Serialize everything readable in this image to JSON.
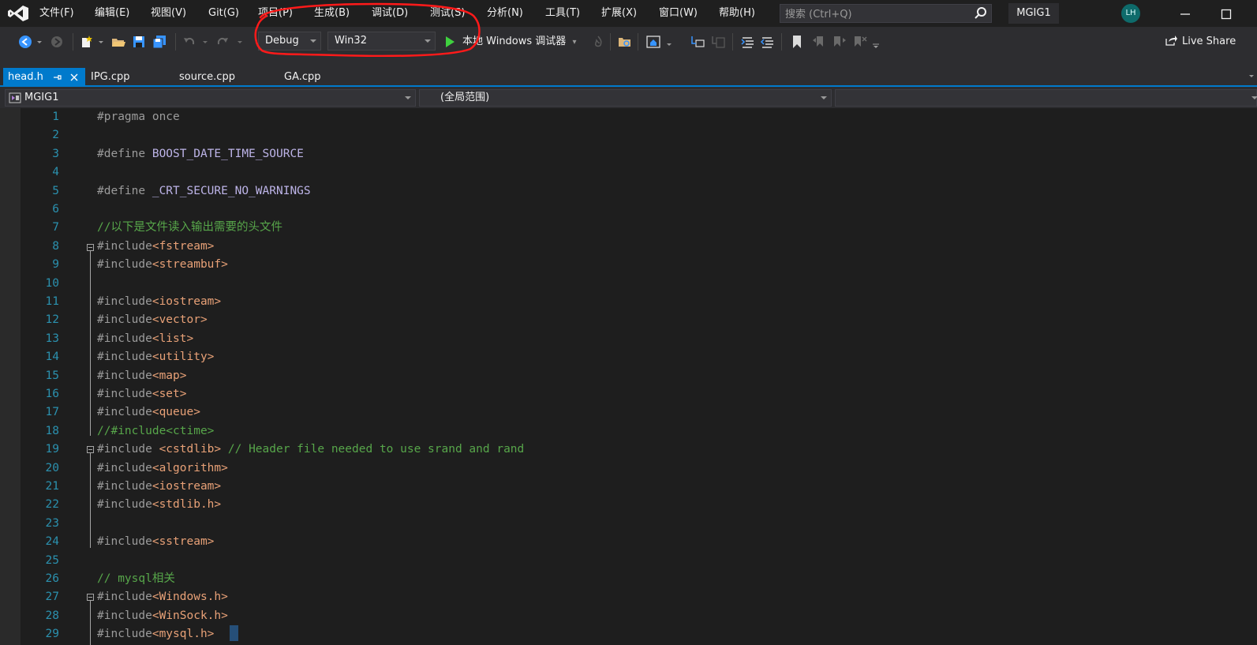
{
  "menu": {
    "items": [
      "文件(F)",
      "编辑(E)",
      "视图(V)",
      "Git(G)",
      "项目(P)",
      "生成(B)",
      "调试(D)",
      "测试(S)",
      "分析(N)",
      "工具(T)",
      "扩展(X)",
      "窗口(W)",
      "帮助(H)"
    ]
  },
  "search": {
    "placeholder": "搜索 (Ctrl+Q)"
  },
  "solution_name": "MGIG1",
  "user_initials": "LH",
  "toolbar": {
    "config": "Debug",
    "platform": "Win32",
    "debugger": "本地 Windows 调试器",
    "live_share": "Live Share"
  },
  "tabs": [
    {
      "label": "head.h",
      "active": true
    },
    {
      "label": "IPG.cpp"
    },
    {
      "label": "source.cpp"
    },
    {
      "label": "GA.cpp"
    }
  ],
  "navbar": {
    "project": "MGIG1",
    "scope": "(全局范围)"
  },
  "code": {
    "lines": [
      {
        "num": "1",
        "parts": [
          [
            "pp",
            "#pragma once"
          ]
        ]
      },
      {
        "num": "2",
        "parts": []
      },
      {
        "num": "3",
        "parts": [
          [
            "pp",
            "#define "
          ],
          [
            "mac",
            "BOOST_DATE_TIME_SOURCE"
          ]
        ]
      },
      {
        "num": "4",
        "parts": []
      },
      {
        "num": "5",
        "parts": [
          [
            "pp",
            "#define "
          ],
          [
            "mac",
            "_CRT_SECURE_NO_WARNINGS"
          ]
        ]
      },
      {
        "num": "6",
        "parts": []
      },
      {
        "num": "7",
        "parts": [
          [
            "com",
            "//以下是文件读入输出需要的头文件"
          ]
        ]
      },
      {
        "num": "8",
        "parts": [
          [
            "pp",
            "#include"
          ],
          [
            "str",
            "<fstream>"
          ]
        ]
      },
      {
        "num": "9",
        "parts": [
          [
            "pp",
            "#include"
          ],
          [
            "str",
            "<streambuf>"
          ]
        ]
      },
      {
        "num": "10",
        "parts": []
      },
      {
        "num": "11",
        "parts": [
          [
            "pp",
            "#include"
          ],
          [
            "str",
            "<iostream>"
          ]
        ]
      },
      {
        "num": "12",
        "parts": [
          [
            "pp",
            "#include"
          ],
          [
            "str",
            "<vector>"
          ]
        ]
      },
      {
        "num": "13",
        "parts": [
          [
            "pp",
            "#include"
          ],
          [
            "str",
            "<list>"
          ]
        ]
      },
      {
        "num": "14",
        "parts": [
          [
            "pp",
            "#include"
          ],
          [
            "str",
            "<utility>"
          ]
        ]
      },
      {
        "num": "15",
        "parts": [
          [
            "pp",
            "#include"
          ],
          [
            "str",
            "<map>"
          ]
        ]
      },
      {
        "num": "16",
        "parts": [
          [
            "pp",
            "#include"
          ],
          [
            "str",
            "<set>"
          ]
        ]
      },
      {
        "num": "17",
        "parts": [
          [
            "pp",
            "#include"
          ],
          [
            "str",
            "<queue>"
          ]
        ]
      },
      {
        "num": "18",
        "parts": [
          [
            "com",
            "//#include<ctime>"
          ]
        ]
      },
      {
        "num": "19",
        "parts": [
          [
            "pp",
            "#include "
          ],
          [
            "str",
            "<cstdlib>"
          ],
          [
            "com",
            " // Header file needed to use srand and rand"
          ]
        ]
      },
      {
        "num": "20",
        "parts": [
          [
            "pp",
            "#include"
          ],
          [
            "str",
            "<algorithm>"
          ]
        ]
      },
      {
        "num": "21",
        "parts": [
          [
            "pp",
            "#include"
          ],
          [
            "str",
            "<iostream>"
          ]
        ]
      },
      {
        "num": "22",
        "parts": [
          [
            "pp",
            "#include"
          ],
          [
            "str",
            "<stdlib.h>"
          ]
        ]
      },
      {
        "num": "23",
        "parts": []
      },
      {
        "num": "24",
        "parts": [
          [
            "pp",
            "#include"
          ],
          [
            "str",
            "<sstream>"
          ]
        ]
      },
      {
        "num": "25",
        "parts": []
      },
      {
        "num": "26",
        "parts": [
          [
            "com",
            "// mysql相关"
          ]
        ]
      },
      {
        "num": "27",
        "parts": [
          [
            "pp",
            "#include"
          ],
          [
            "str",
            "<Windows.h>"
          ]
        ]
      },
      {
        "num": "28",
        "parts": [
          [
            "pp",
            "#include"
          ],
          [
            "str",
            "<WinSock.h>"
          ]
        ]
      },
      {
        "num": "29",
        "parts": [
          [
            "pp",
            "#include"
          ],
          [
            "str",
            "<mysql.h>"
          ]
        ]
      }
    ]
  },
  "colors": {
    "accent": "#007acc",
    "annotation": "#ff1a1a",
    "run_green": "#3fd13f"
  }
}
